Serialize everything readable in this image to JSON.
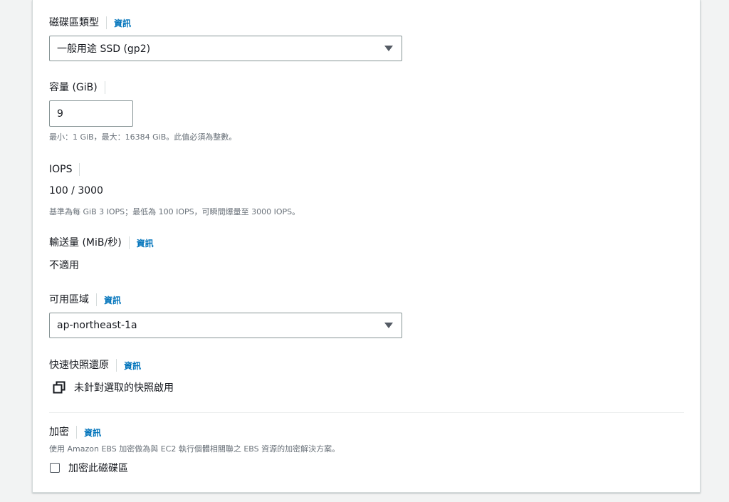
{
  "volume_type": {
    "label": "磁碟區類型",
    "info": "資訊",
    "selected": "一般用途 SSD (gp2)"
  },
  "size": {
    "label": "容量 (GiB)",
    "value": "9",
    "help": "最小：1 GiB，最大：16384 GiB。此值必須為整數。"
  },
  "iops": {
    "label": "IOPS",
    "value": "100 / 3000",
    "help": "基準為每 GiB 3 IOPS；最低為 100 IOPS，可瞬間爆量至 3000 IOPS。"
  },
  "throughput": {
    "label": "輸送量 (MiB/秒)",
    "info": "資訊",
    "value": "不適用"
  },
  "availability_zone": {
    "label": "可用區域",
    "info": "資訊",
    "selected": "ap-northeast-1a"
  },
  "fast_snapshot_restore": {
    "label": "快速快照還原",
    "info": "資訊",
    "status": "未針對選取的快照啟用"
  },
  "encryption": {
    "label": "加密",
    "info": "資訊",
    "description": "使用 Amazon EBS 加密做為與 EC2 執行個體相關聯之 EBS 資源的加密解決方案。",
    "checkbox_label": "加密此磁碟區"
  },
  "colors": {
    "link": "#0073bb",
    "border": "#879596",
    "help_text": "#687078",
    "page_bg": "#f2f3f3"
  }
}
